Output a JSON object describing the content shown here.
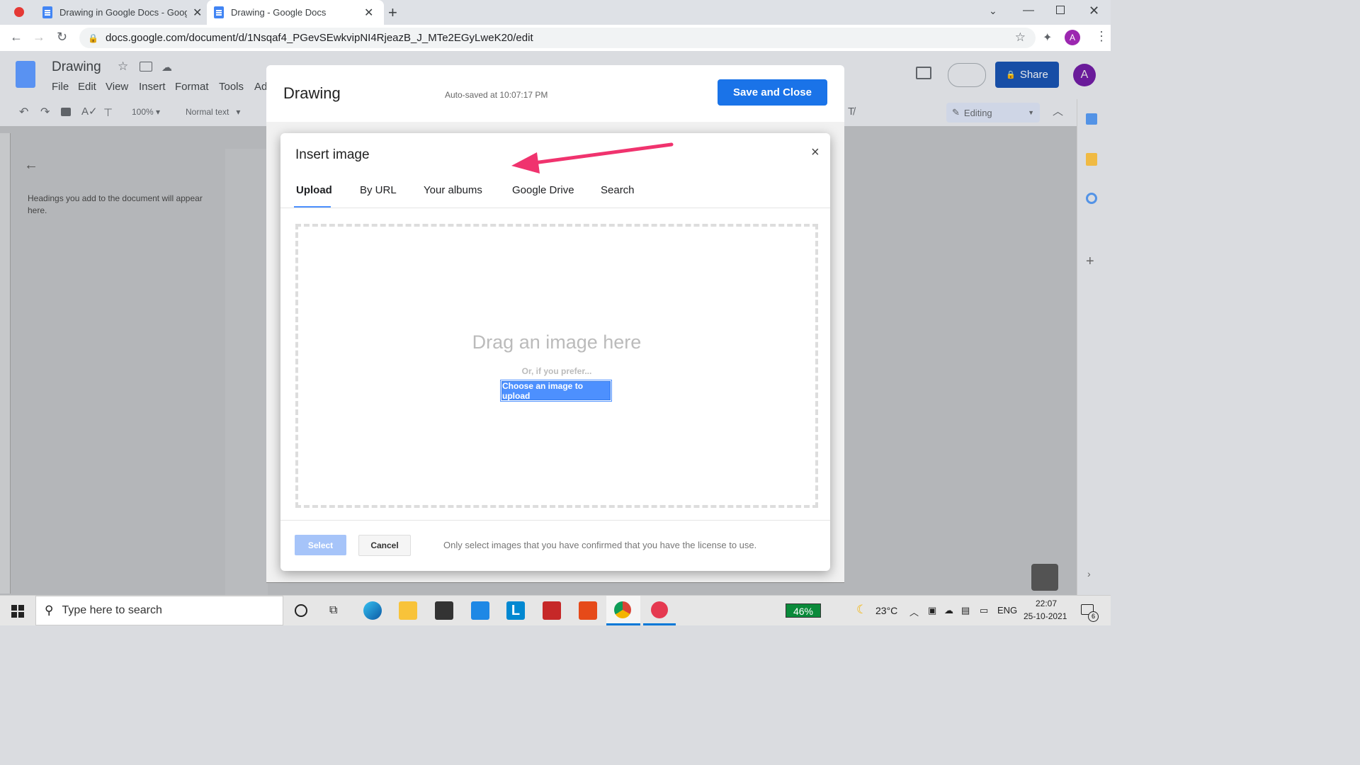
{
  "browser": {
    "tabs": [
      {
        "title": "Drawing in Google Docs - Googl"
      },
      {
        "title": "Drawing - Google Docs"
      }
    ],
    "url": "docs.google.com/document/d/1Nsqaf4_PGevSEwkvipNI4RjeazB_J_MTe2EGyLweK20/edit",
    "profile_initial": "A"
  },
  "docs": {
    "title": "Drawing",
    "menu": [
      "File",
      "Edit",
      "View",
      "Insert",
      "Format",
      "Tools",
      "Ad"
    ],
    "share_label": "Share",
    "avatar": "A",
    "zoom": "100%",
    "style": "Normal text",
    "editing_label": "Editing",
    "outline_hint": "Headings you add to the document will appear here."
  },
  "drawing": {
    "title": "Drawing",
    "autosave": "Auto-saved at 10:07:17 PM",
    "save_close_label": "Save and Close"
  },
  "insert_image": {
    "title": "Insert image",
    "close": "×",
    "tabs": [
      "Upload",
      "By URL",
      "Your albums",
      "Google Drive",
      "Search"
    ],
    "active_tab": "Upload",
    "drag_text": "Drag an image here",
    "or_text": "Or, if you prefer...",
    "choose_label": "Choose an image to upload",
    "select_label": "Select",
    "cancel_label": "Cancel",
    "license_note": "Only select images that you have confirmed that you have the license to use."
  },
  "taskbar": {
    "search_placeholder": "Type here to search",
    "battery": "46%",
    "temperature": "23°C",
    "language": "ENG",
    "time": "22:07",
    "date": "25-10-2021",
    "notification_count": "6"
  },
  "colors": {
    "accent": "#1a73e8",
    "annotation_arrow": "#f0336e"
  }
}
